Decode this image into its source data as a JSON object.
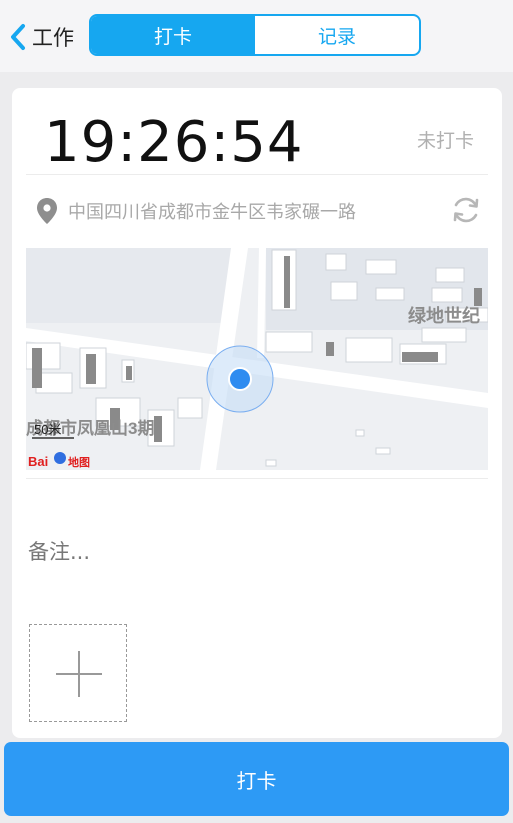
{
  "header": {
    "back_label": "工作",
    "tabs": [
      "打卡",
      "记录"
    ],
    "active_tab": "打卡"
  },
  "clock": {
    "time": "19:26:54",
    "status": "未打卡"
  },
  "location": {
    "address": "中国四川省成都市金牛区韦家碾一路"
  },
  "map": {
    "scale_label": "50米",
    "label_right": "绿地世纪",
    "label_left": "成都市凤凰山3期",
    "logo_text": "Bai",
    "logo_suffix": "地图"
  },
  "remark": {
    "placeholder": "备注..."
  },
  "punch_button": {
    "label": "打卡"
  },
  "colors": {
    "accent": "#16a7f0",
    "button": "#2d9af5",
    "location_dot": "#2f8cf0"
  },
  "icons": [
    "chevron-left-icon",
    "location-pin-icon",
    "refresh-icon",
    "add-photo-icon",
    "baidu-logo-icon"
  ]
}
